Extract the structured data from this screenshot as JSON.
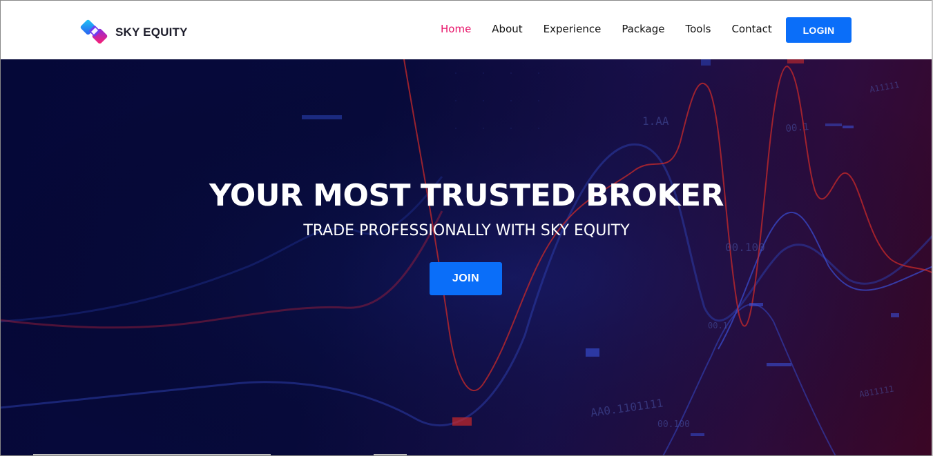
{
  "brand": {
    "name": "SKY EQUITY",
    "colors": {
      "accent": "#e8156a",
      "button": "#0a6ef9",
      "hero_dark": "#050838",
      "hero_red": "#3a0624"
    }
  },
  "nav": {
    "items": [
      {
        "label": "Home",
        "active": true
      },
      {
        "label": "About",
        "active": false
      },
      {
        "label": "Experience",
        "active": false
      },
      {
        "label": "Package",
        "active": false
      },
      {
        "label": "Tools",
        "active": false
      },
      {
        "label": "Contact",
        "active": false
      }
    ],
    "login_label": "LOGIN"
  },
  "hero": {
    "title": "YOUR MOST TRUSTED BROKER",
    "subtitle": "TRADE PROFESSIONALLY WITH SKY EQUITY",
    "cta_label": "JOIN",
    "background_labels": [
      "1.AA",
      "00.1",
      "00.100",
      "00.1",
      "AA0.1101111",
      "00.100",
      "A11111",
      "A811111"
    ]
  }
}
